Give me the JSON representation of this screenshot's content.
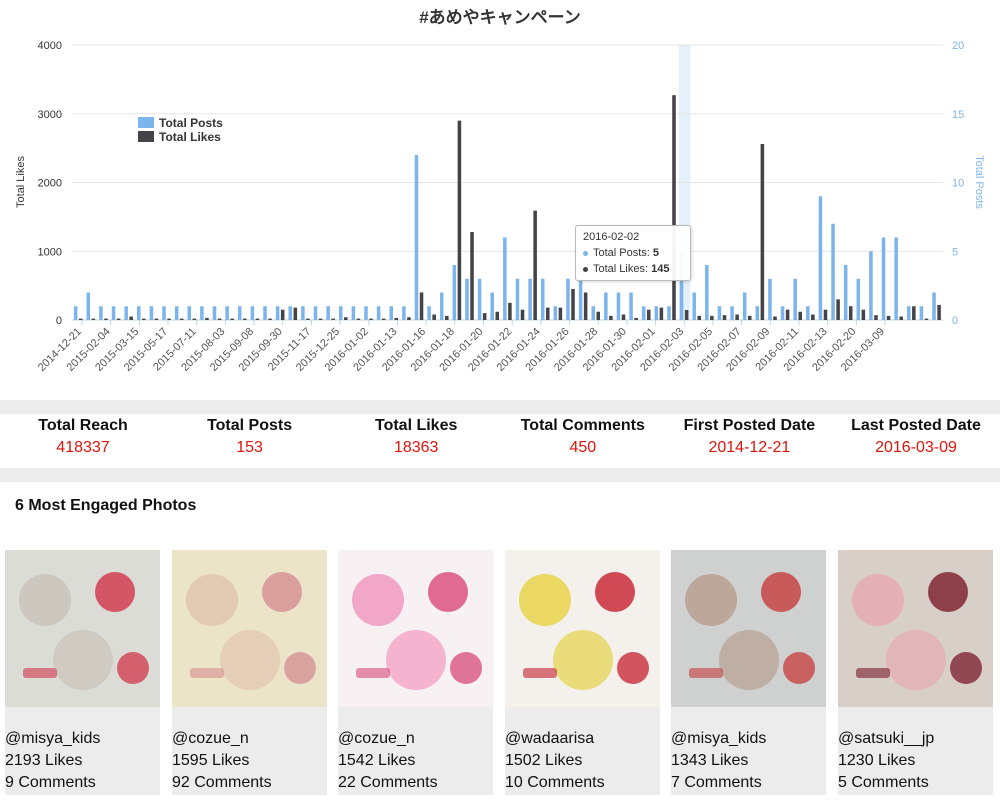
{
  "chart_data": {
    "type": "bar",
    "title": "#あめやキャンペーン",
    "ylabel": "Total Likes",
    "y2label": "Total Posts",
    "ylim": [
      0,
      4000
    ],
    "y2lim": [
      0,
      20
    ],
    "yticks": [
      "0",
      "1000",
      "2000",
      "3000",
      "4000"
    ],
    "y2ticks": [
      "0",
      "5",
      "10",
      "15",
      "20"
    ],
    "xticks": [
      "2014-12-21",
      "2015-02-04",
      "2015-03-15",
      "2015-05-17",
      "2015-07-11",
      "2015-08-03",
      "2015-09-08",
      "2015-09-30",
      "2015-11-17",
      "2015-12-25",
      "2016-01-02",
      "2016-01-13",
      "2016-01-16",
      "2016-01-18",
      "2016-01-20",
      "2016-01-22",
      "2016-01-24",
      "2016-01-26",
      "2016-01-28",
      "2016-01-30",
      "2016-02-01",
      "2016-02-03",
      "2016-02-05",
      "2016-02-07",
      "2016-02-09",
      "2016-02-11",
      "2016-02-13",
      "2016-02-20",
      "2016-03-09"
    ],
    "legend_position": "top-left",
    "grid": true,
    "series": [
      {
        "name": "Total Posts",
        "axis": "right",
        "color": "#7cb5ec",
        "values": [
          1,
          2,
          1,
          1,
          1,
          1,
          1,
          1,
          1,
          1,
          1,
          1,
          1,
          1,
          1,
          1,
          1,
          1,
          1,
          1,
          1,
          1,
          1,
          1,
          1,
          1,
          1,
          12,
          1,
          2,
          4,
          3,
          3,
          2,
          6,
          3,
          3,
          3,
          1,
          3,
          3,
          1,
          2,
          2,
          2,
          1,
          1,
          1,
          5,
          2,
          4,
          1,
          1,
          2,
          1,
          3,
          1,
          3,
          1,
          9,
          7,
          4,
          3,
          5,
          6,
          6,
          1,
          1,
          2
        ],
        "highlight_index": 48
      },
      {
        "name": "Total Likes",
        "axis": "left",
        "color": "#434348",
        "values": [
          20,
          20,
          20,
          20,
          50,
          20,
          20,
          20,
          20,
          20,
          30,
          20,
          20,
          20,
          20,
          20,
          150,
          180,
          20,
          20,
          20,
          40,
          20,
          20,
          20,
          30,
          40,
          400,
          80,
          60,
          2900,
          1280,
          100,
          120,
          250,
          150,
          1590,
          180,
          180,
          450,
          400,
          120,
          60,
          80,
          30,
          150,
          180,
          3270,
          145,
          60,
          60,
          70,
          80,
          60,
          2560,
          50,
          150,
          120,
          80,
          150,
          300,
          200,
          150,
          70,
          60,
          50,
          200,
          20,
          220
        ]
      }
    ],
    "tooltip": {
      "date": "2016-02-02",
      "posts_label": "Total Posts: ",
      "posts_value": "5",
      "likes_label": "Total Likes: ",
      "likes_value": "145"
    }
  },
  "stats": [
    {
      "label": "Total Reach",
      "value": "418337"
    },
    {
      "label": "Total Posts",
      "value": "153"
    },
    {
      "label": "Total Likes",
      "value": "18363"
    },
    {
      "label": "Total Comments",
      "value": "450"
    },
    {
      "label": "First Posted Date",
      "value": "2014-12-21"
    },
    {
      "label": "Last Posted Date",
      "value": "2016-03-09"
    }
  ],
  "photos_title": "6 Most Engaged Photos",
  "photos": [
    {
      "user": "@misya_kids",
      "likes": "2193 Likes",
      "comments": "9 Comments",
      "palette": [
        "#dcdcd7",
        "#c9c3bb",
        "#d2354a"
      ]
    },
    {
      "user": "@cozue_n",
      "likes": "1595 Likes",
      "comments": "92 Comments",
      "palette": [
        "#ece4c9",
        "#e2c5b0",
        "#d68d92"
      ]
    },
    {
      "user": "@cozue_n",
      "likes": "1542 Likes",
      "comments": "22 Comments",
      "palette": [
        "#f7f1f3",
        "#f29ac0",
        "#d84a79"
      ]
    },
    {
      "user": "@wadaarisa",
      "likes": "1502 Likes",
      "comments": "10 Comments",
      "palette": [
        "#f4f1ed",
        "#e7d34a",
        "#c71f2d"
      ]
    },
    {
      "user": "@misya_kids",
      "likes": "1343 Likes",
      "comments": "7 Comments",
      "palette": [
        "#cfd0d0",
        "#b8a090",
        "#c73c3c"
      ]
    },
    {
      "user": "@satsuki__jp",
      "likes": "1230 Likes",
      "comments": "5 Comments",
      "palette": [
        "#d8cfc9",
        "#e7a9b5",
        "#7a1b2b"
      ]
    }
  ]
}
